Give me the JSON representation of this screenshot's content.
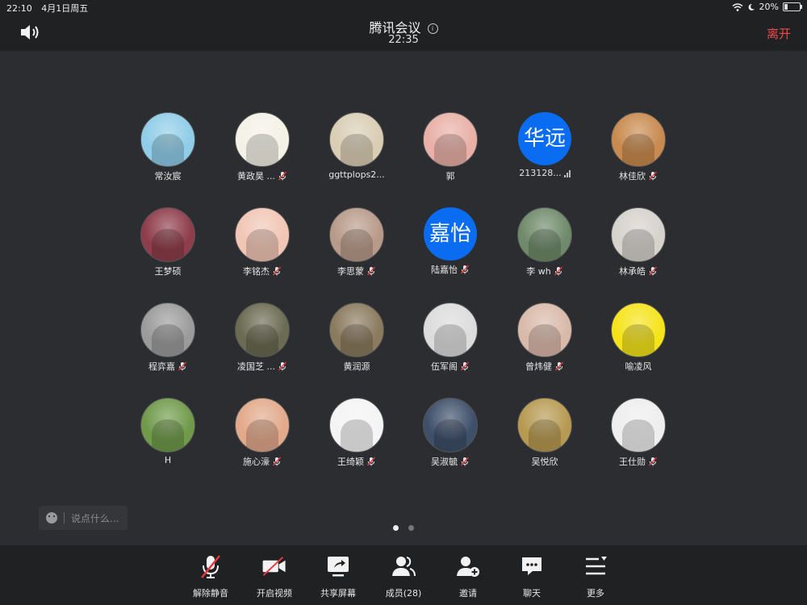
{
  "status_bar": {
    "time": "22:10",
    "date": "4月1日周五",
    "battery": "20%",
    "battery_level": 0.2
  },
  "header": {
    "title": "腾讯会议",
    "timer": "22:35",
    "leave_label": "离开"
  },
  "participants": [
    {
      "name": "常汝宸",
      "avatar": "pic",
      "color": "#8fcde8",
      "muted": false
    },
    {
      "name": "黄政昊 ...",
      "avatar": "pic",
      "color": "#f4f1e6",
      "muted": true
    },
    {
      "name": "ggttplops2...",
      "avatar": "pic",
      "color": "#d9cdb4",
      "muted": false
    },
    {
      "name": "郭",
      "avatar": "pic",
      "color": "#e8b0a6",
      "muted": false
    },
    {
      "name": "213128...",
      "avatar": "text",
      "avatar_text": "华远",
      "muted": false,
      "signal": true
    },
    {
      "name": "林佳欣",
      "avatar": "pic",
      "color": "#c88a4e",
      "muted": true
    },
    {
      "name": "王梦硕",
      "avatar": "pic",
      "color": "#8e3d4a",
      "muted": false
    },
    {
      "name": "李铭杰",
      "avatar": "pic",
      "color": "#f1c6b5",
      "muted": true
    },
    {
      "name": "李思蒙",
      "avatar": "pic",
      "color": "#b89a8a",
      "muted": true
    },
    {
      "name": "陆嘉怡",
      "avatar": "text",
      "avatar_text": "嘉怡",
      "muted": true
    },
    {
      "name": "李 wh",
      "avatar": "pic",
      "color": "#6f8a6a",
      "muted": true
    },
    {
      "name": "林承皓",
      "avatar": "pic",
      "color": "#d6d2cc",
      "muted": true
    },
    {
      "name": "程弈嘉",
      "avatar": "pic",
      "color": "#9b9b9b",
      "muted": true
    },
    {
      "name": "凌国芝 ...",
      "avatar": "pic",
      "color": "#6b6a52",
      "muted": true
    },
    {
      "name": "黄润源",
      "avatar": "pic",
      "color": "#8a7a5e",
      "muted": false
    },
    {
      "name": "伍军阁",
      "avatar": "pic",
      "color": "#dcdcdc",
      "muted": true
    },
    {
      "name": "曾炜健",
      "avatar": "pic",
      "color": "#d9b9a9",
      "muted": true
    },
    {
      "name": "喻凌风",
      "avatar": "pic",
      "color": "#f5e31a",
      "muted": false
    },
    {
      "name": "H",
      "avatar": "pic",
      "color": "#6f9a4a",
      "muted": false
    },
    {
      "name": "施心濠",
      "avatar": "pic",
      "color": "#e2a98a",
      "muted": true
    },
    {
      "name": "王绮颖",
      "avatar": "pic",
      "color": "#f4f4f4",
      "muted": true
    },
    {
      "name": "吴淑毓",
      "avatar": "pic",
      "color": "#3e4f6a",
      "muted": true
    },
    {
      "name": "吴悦欣",
      "avatar": "pic",
      "color": "#b79a52",
      "muted": false
    },
    {
      "name": "王仕勋",
      "avatar": "pic",
      "color": "#eeeeee",
      "muted": true
    }
  ],
  "chat": {
    "placeholder": "说点什么..."
  },
  "pager": {
    "pages": 2,
    "current": 1
  },
  "toolbar": [
    {
      "label": "解除静音",
      "icon": "mic-off-icon"
    },
    {
      "label": "开启视频",
      "icon": "video-off-icon"
    },
    {
      "label": "共享屏幕",
      "icon": "share-screen-icon"
    },
    {
      "label": "成员(28)",
      "icon": "members-icon"
    },
    {
      "label": "邀请",
      "icon": "invite-icon"
    },
    {
      "label": "聊天",
      "icon": "chat-icon"
    },
    {
      "label": "更多",
      "icon": "more-icon"
    }
  ]
}
